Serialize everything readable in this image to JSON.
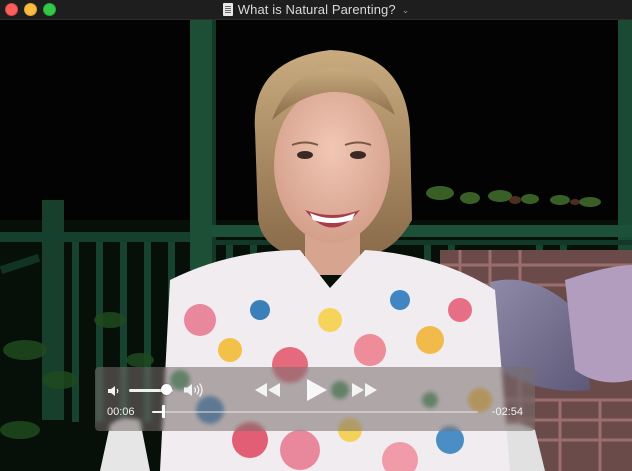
{
  "window": {
    "title": "What is Natural Parenting?",
    "controls": [
      "close-button",
      "minimize-button",
      "maximize-button"
    ]
  },
  "player": {
    "elapsed": "00:06",
    "remaining": "-02:54",
    "progress": 0.034,
    "volume": 0.85,
    "icons": {
      "volume_low": "speaker-low-icon",
      "volume_high": "speaker-high-icon",
      "rewind": "rewind-icon",
      "play": "play-icon",
      "fast_forward": "fast-forward-icon"
    }
  }
}
